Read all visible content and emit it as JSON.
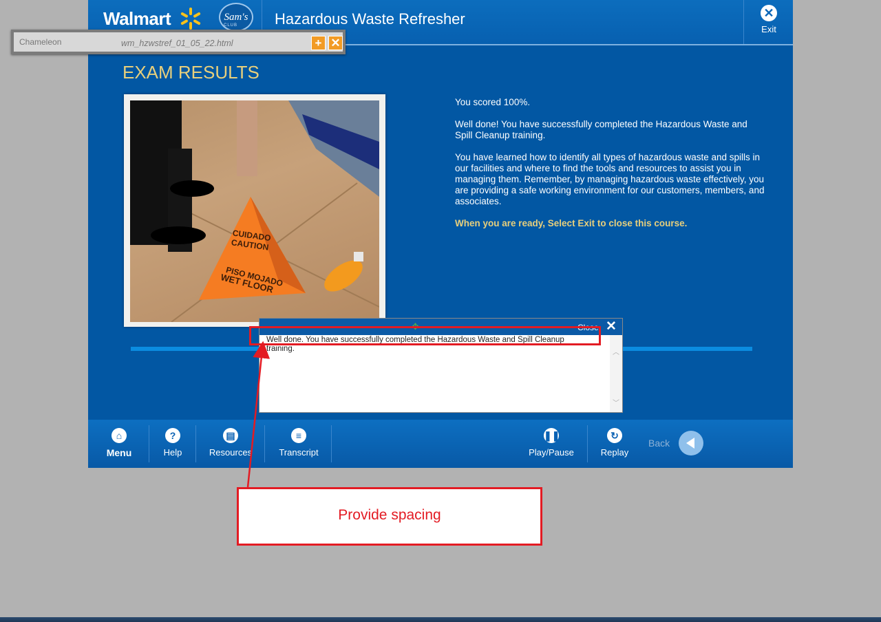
{
  "header": {
    "brand": "Walmart",
    "sams": "Sam's",
    "sams_sub": "CLUB",
    "title": "Hazardous Waste Refresher",
    "exit_label": "Exit"
  },
  "chameleon": {
    "logo": "Chameleon",
    "filename": "wm_hzwstref_01_05_22.html"
  },
  "main": {
    "heading": "EXAM RESULTS",
    "score": "You scored 100%.",
    "para1": "Well done!  You have successfully completed the Hazardous Waste and Spill Cleanup training.",
    "para2": "You have learned how to identify all types of hazardous waste and spills in our facilities and where to find the tools and resources to assist you in managing them.  Remember, by managing hazardous waste effectively, you are providing a safe working environment for our customers, members, and associates.",
    "ready": "When you are ready, Select Exit to close this course.",
    "sign_line1": "CUIDADO",
    "sign_line2": "CAUTION",
    "sign_line3": "PISO MOJADO",
    "sign_line4": "WET FLOOR"
  },
  "transcript_popup": {
    "close_label": "Close",
    "text": "Well done.  You have successfully completed the Hazardous Waste and Spill Cleanup training."
  },
  "footer": {
    "menu": "Menu",
    "help": "Help",
    "resources": "Resources",
    "transcript": "Transcript",
    "play_pause": "Play/Pause",
    "replay": "Replay",
    "back": "Back"
  },
  "annotation": {
    "comment": "Provide spacing"
  },
  "colors": {
    "course_bg": "#0257a3",
    "accent_gold": "#e8cf7c",
    "annotation_red": "#e31b23"
  }
}
